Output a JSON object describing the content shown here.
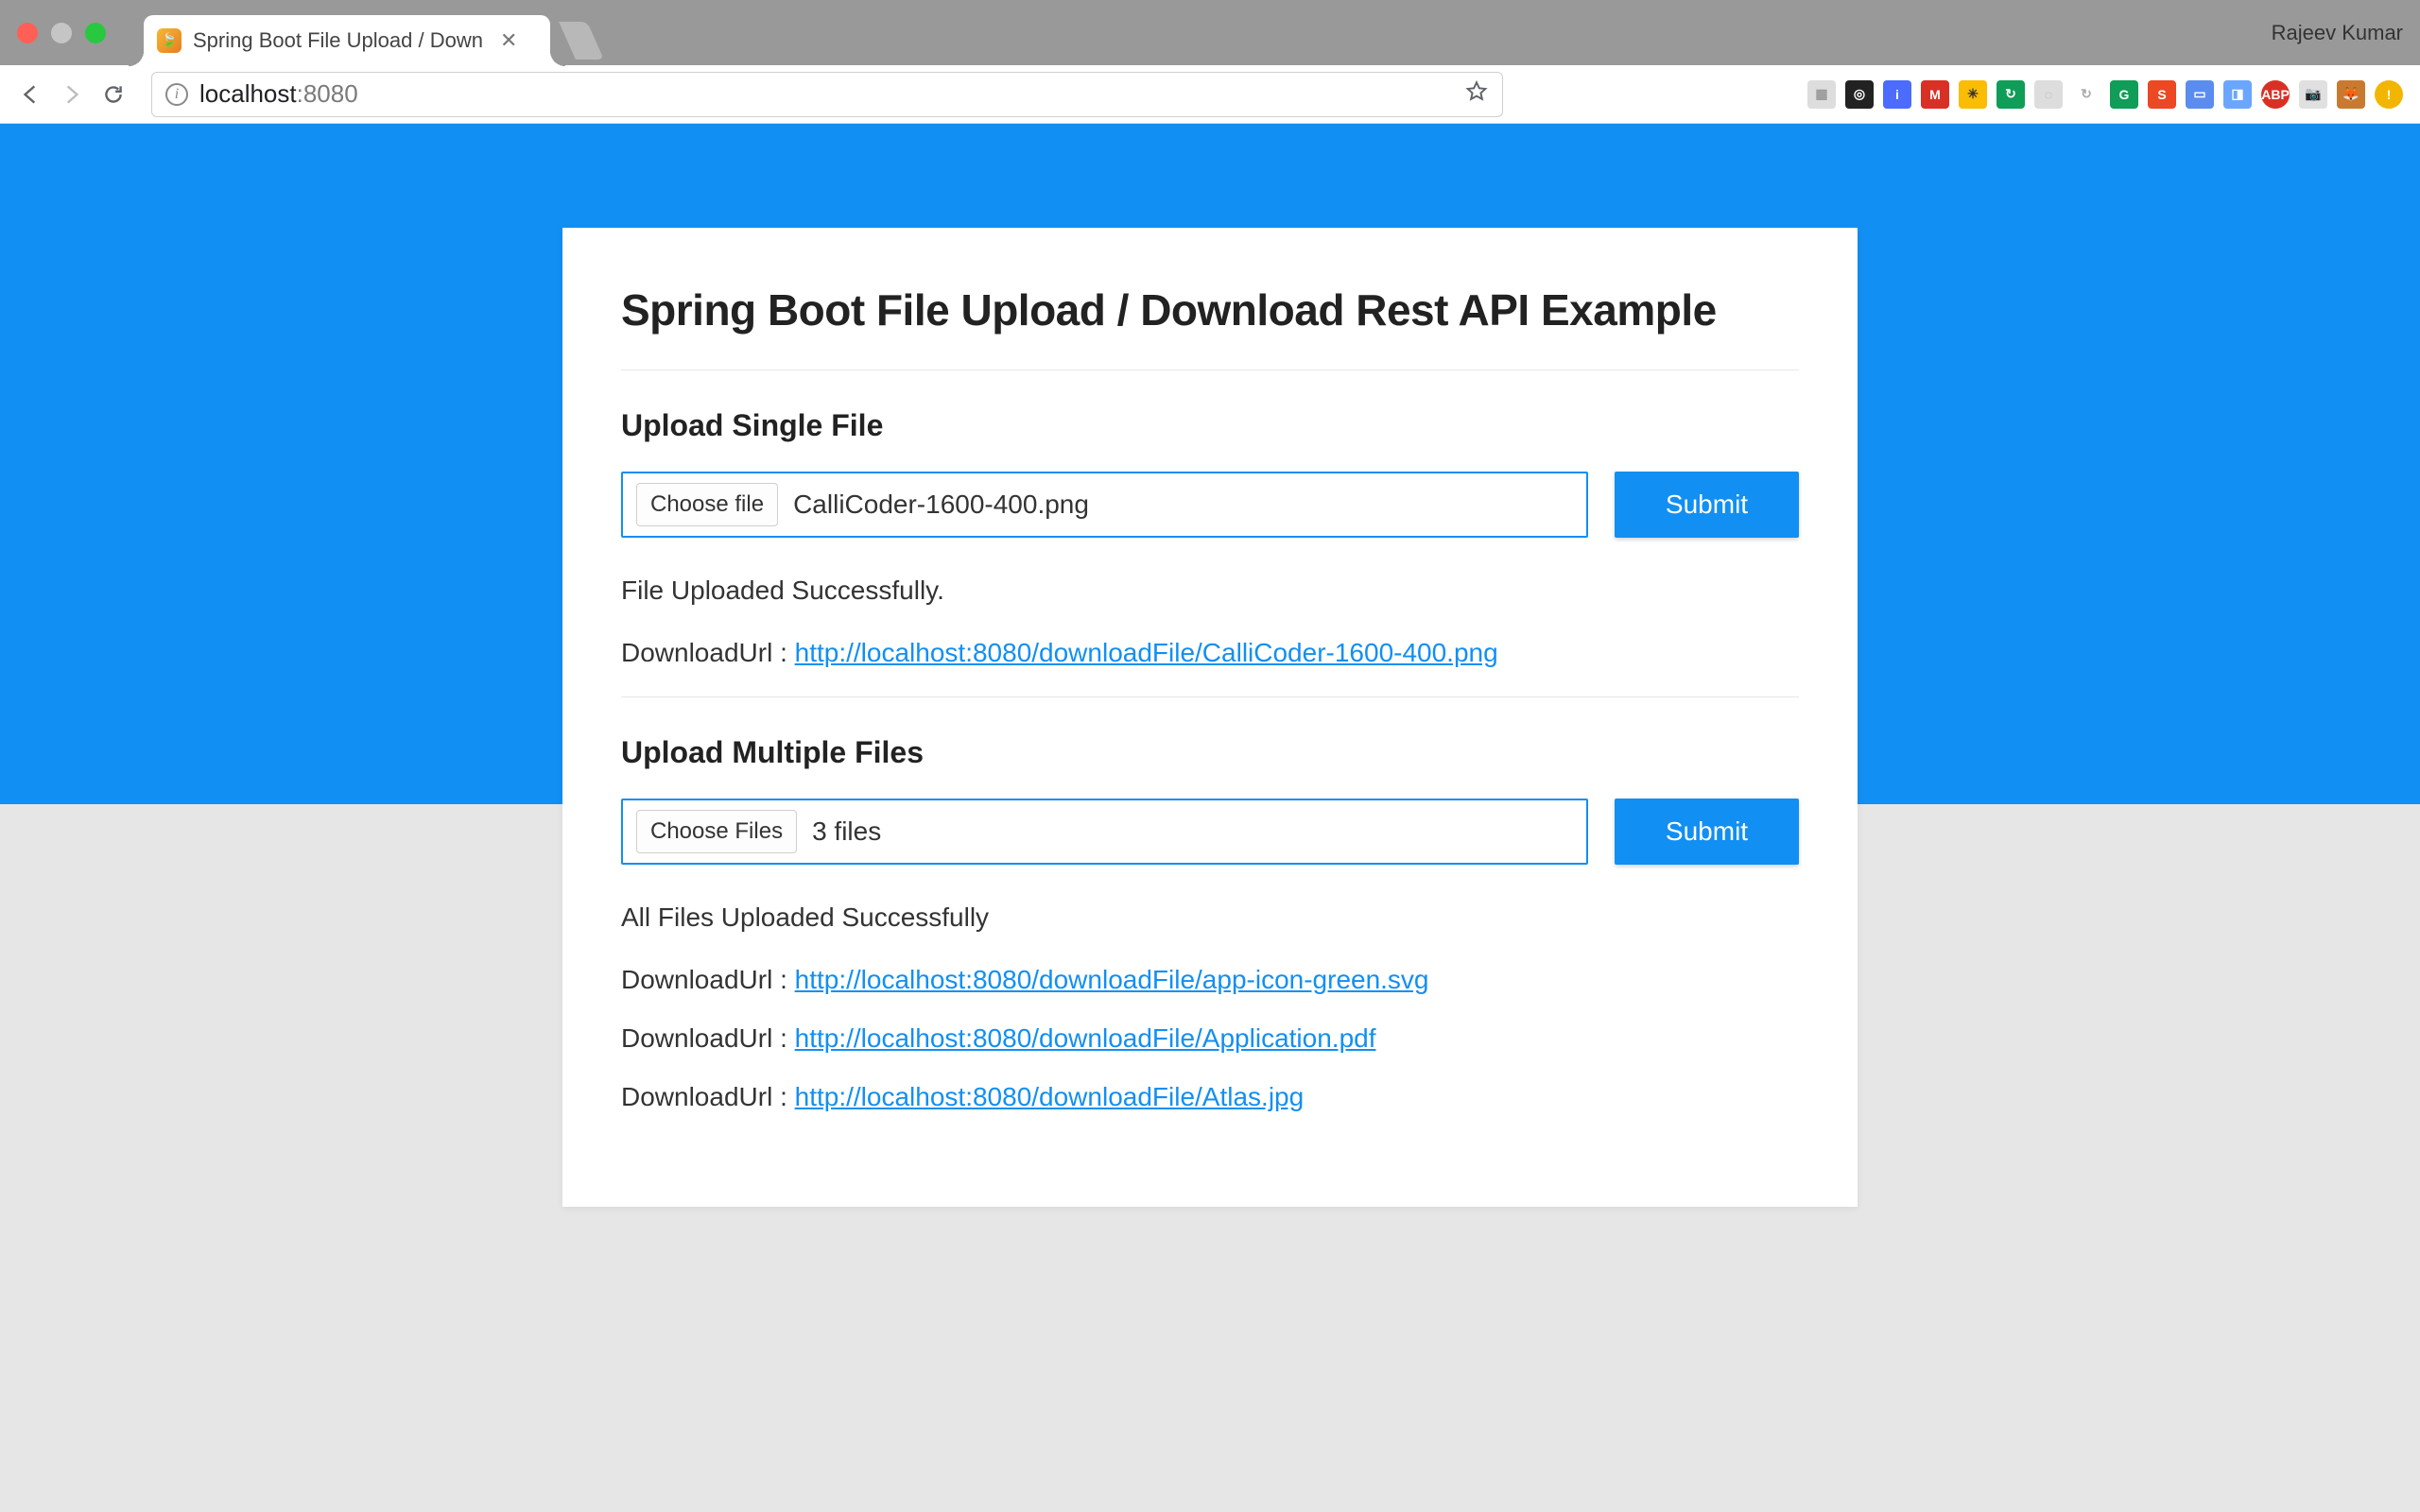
{
  "browser": {
    "tab_title": "Spring Boot File Upload / Down",
    "profile_name": "Rajeev Kumar",
    "url_host": "localhost",
    "url_port": ":8080"
  },
  "page": {
    "heading": "Spring Boot File Upload / Download Rest API Example",
    "single": {
      "title": "Upload Single File",
      "choose_label": "Choose file",
      "filename": "CalliCoder-1600-400.png",
      "submit_label": "Submit",
      "status": "File Uploaded Successfully.",
      "download_prefix": "DownloadUrl : ",
      "download_url": "http://localhost:8080/downloadFile/CalliCoder-1600-400.png"
    },
    "multiple": {
      "title": "Upload Multiple Files",
      "choose_label": "Choose Files",
      "filename": "3 files",
      "submit_label": "Submit",
      "status": "All Files Uploaded Successfully",
      "download_prefix": "DownloadUrl : ",
      "downloads": [
        "http://localhost:8080/downloadFile/app-icon-green.svg",
        "http://localhost:8080/downloadFile/Application.pdf",
        "http://localhost:8080/downloadFile/Atlas.jpg"
      ]
    }
  }
}
